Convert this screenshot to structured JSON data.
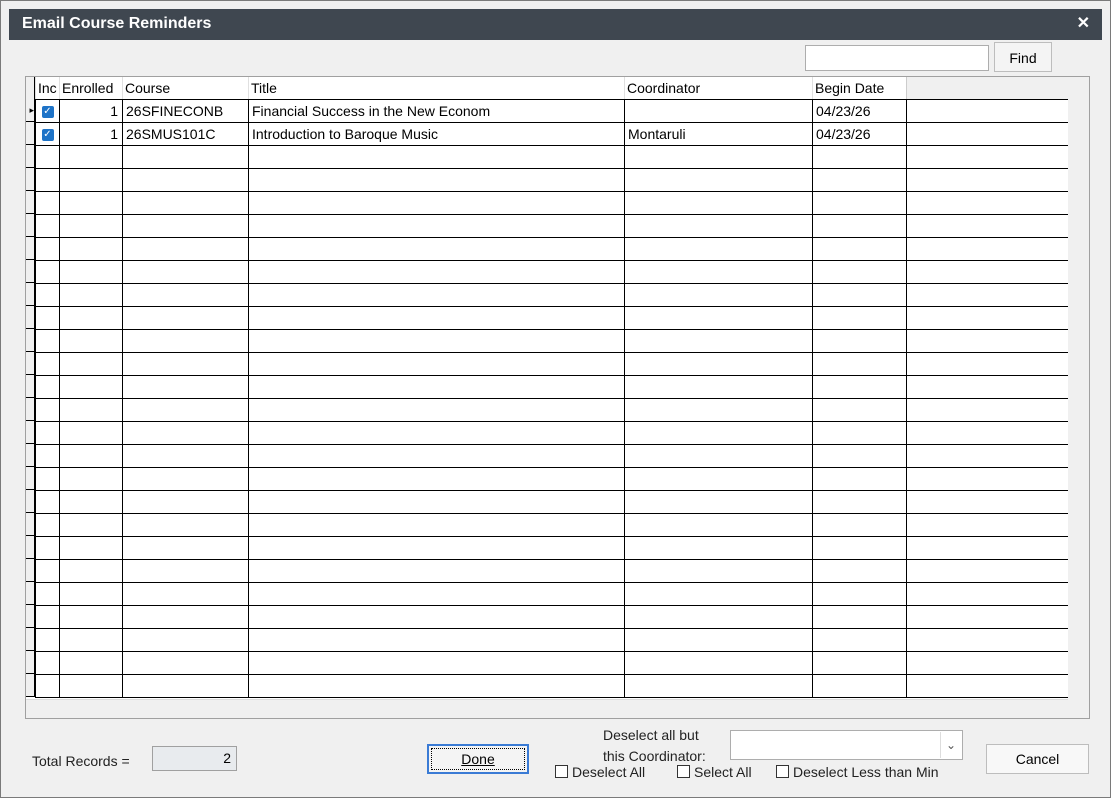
{
  "window": {
    "title": "Email Course Reminders",
    "close_glyph": "✕"
  },
  "search": {
    "value": "",
    "find_label": "Find"
  },
  "table": {
    "columns": [
      "Inc",
      "Enrolled",
      "Course",
      "Title",
      "Coordinator",
      "Begin Date"
    ],
    "rows": [
      {
        "inc": true,
        "enrolled": "1",
        "course": "26SFINECONB",
        "title": "Financial Success in the New Econom",
        "coordinator": "",
        "begin_date": "04/23/26"
      },
      {
        "inc": true,
        "enrolled": "1",
        "course": "26SMUS101C",
        "title": "Introduction to Baroque Music",
        "coordinator": "Montaruli",
        "begin_date": "04/23/26"
      }
    ]
  },
  "footer": {
    "total_label": "Total Records =",
    "total_value": "2",
    "done_label": "Done",
    "deselect_but_label_line1": "Deselect all but",
    "deselect_but_label_line2": "this Coordinator:",
    "coordinator_select_value": "",
    "deselect_all_label": "Deselect All",
    "select_all_label": "Select All",
    "deselect_less_label": "Deselect Less than Min",
    "cancel_label": "Cancel"
  }
}
